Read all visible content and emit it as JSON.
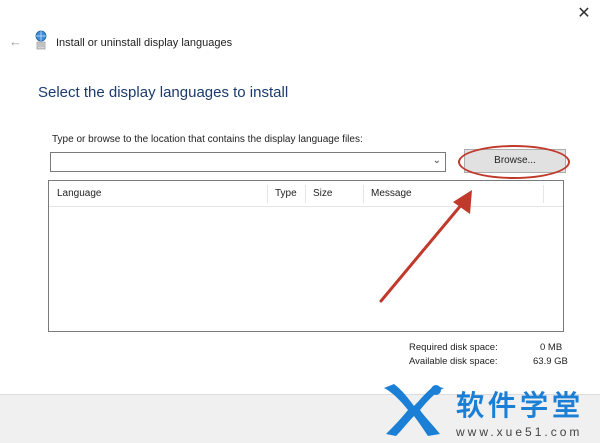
{
  "window": {
    "title": "Install or uninstall display languages",
    "close_glyph": "✕",
    "back_glyph": "←"
  },
  "page": {
    "heading": "Select the display languages to install",
    "instruction": "Type or browse to the location that contains the display language files:",
    "path_value": "",
    "browse_label": "Browse..."
  },
  "table": {
    "columns": [
      "Language",
      "Type",
      "Size",
      "Message"
    ],
    "rows": []
  },
  "disk": {
    "required_label": "Required disk space:",
    "required_value": "0 MB",
    "available_label": "Available disk space:",
    "available_value": "63.9 GB"
  },
  "watermark": {
    "title": "软件学堂",
    "url": "www.xue51.com"
  },
  "colors": {
    "annotation_red": "#c0392b",
    "heading_blue": "#1c3a6e",
    "watermark_blue": "#1b7fd6"
  }
}
